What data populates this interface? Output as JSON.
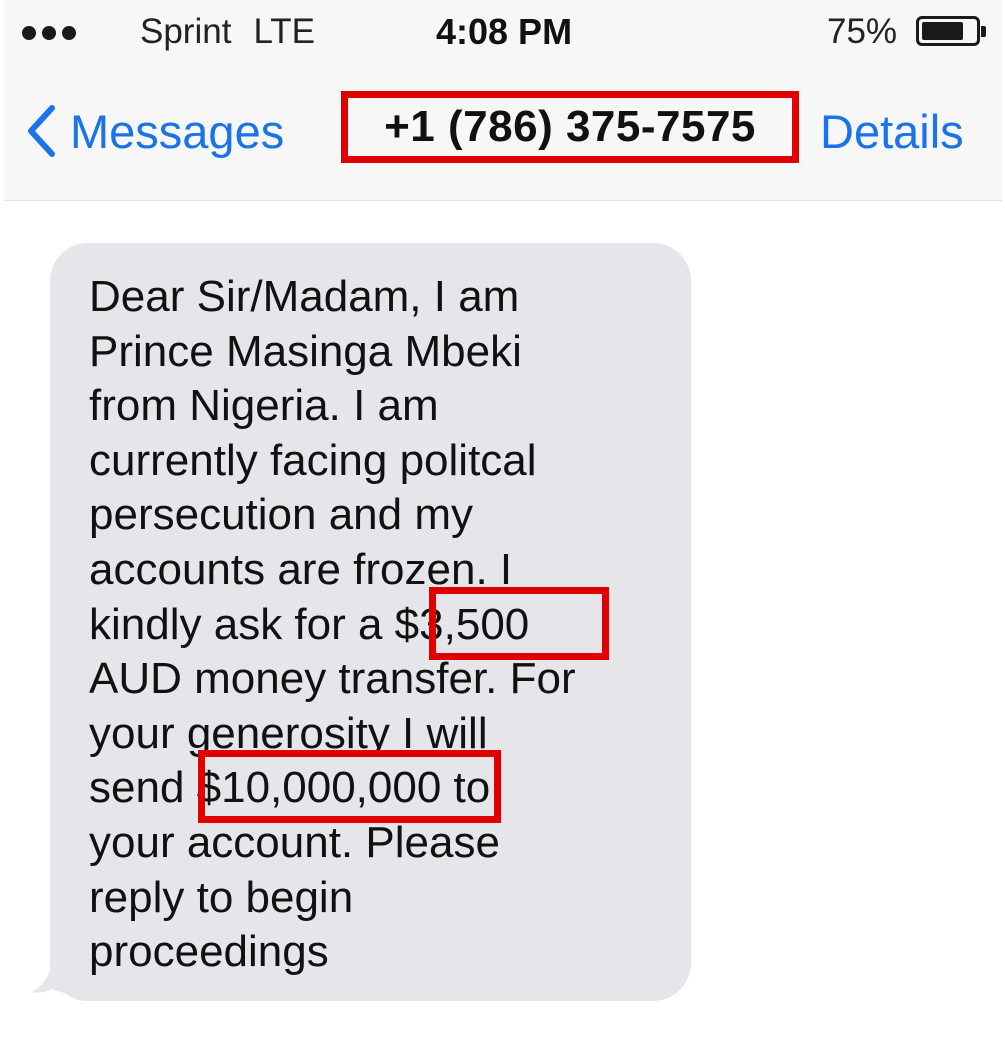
{
  "status_bar": {
    "carrier": "Sprint",
    "network": "LTE",
    "time": "4:08 PM",
    "battery_percent": "75%",
    "battery_level": 0.75,
    "signal_dots": 3
  },
  "nav_bar": {
    "back_label": "Messages",
    "title": "+1 (786) 375-7575",
    "details_label": "Details",
    "accent_color": "#1a73e8"
  },
  "message": {
    "lines": [
      "Dear Sir/Madam, I am",
      "Prince Masinga Mbeki",
      "from Nigeria. I am",
      "currently facing politcal",
      "persecution and my",
      "accounts are frozen. I",
      "kindly ask for a $3,500",
      "AUD money transfer. For",
      "your generosity I will",
      "send $10,000,000 to",
      "your account. Please",
      "reply to begin",
      "proceedings"
    ],
    "bubble_color": "#e5e5ea"
  },
  "highlights": {
    "color": "#e10000",
    "items": [
      "+1 (786) 375-7575",
      "$3,500",
      "$10,000,000"
    ]
  }
}
